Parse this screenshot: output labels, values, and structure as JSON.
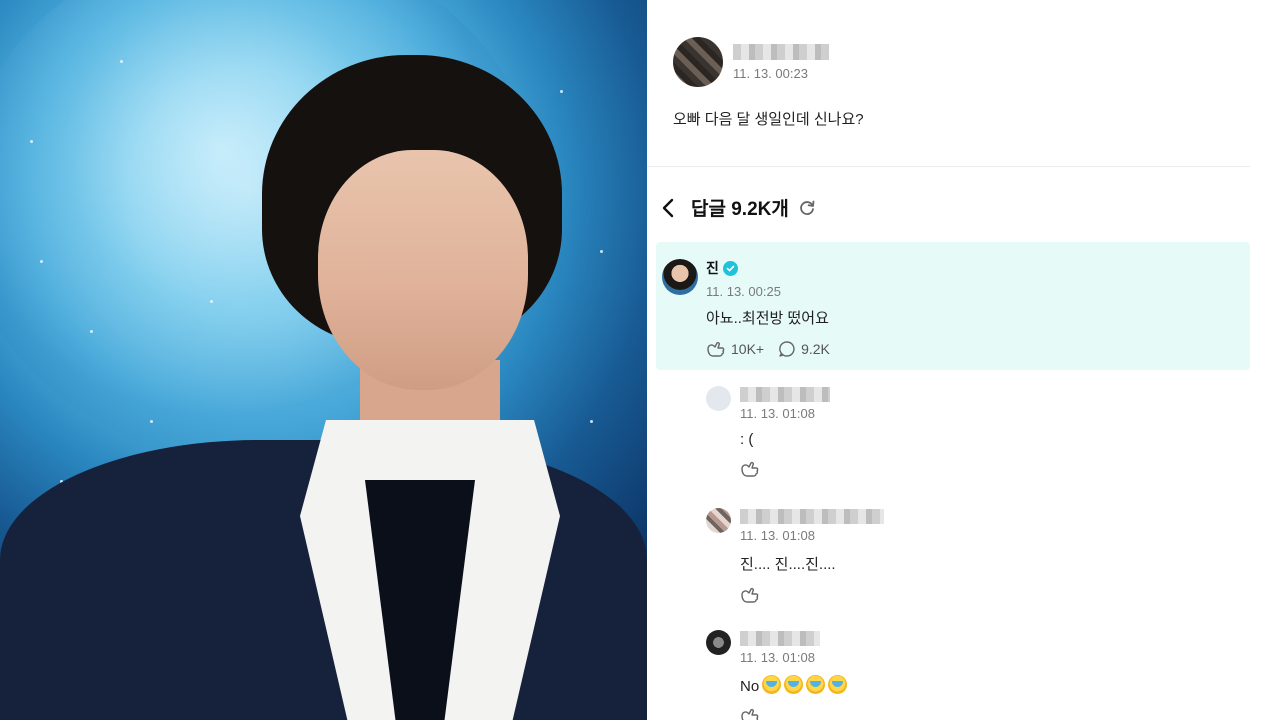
{
  "post": {
    "time": "11. 13. 00:23",
    "text": "오빠 다음 달 생일인데 신나요?"
  },
  "replies_header": {
    "title": "답글 9.2K개"
  },
  "highlighted_reply": {
    "author": "진",
    "time": "11. 13. 00:25",
    "text": "아뇨..최전방 떴어요",
    "likes": "10K+",
    "comments": "9.2K"
  },
  "comments": [
    {
      "time": "11. 13. 01:08",
      "text": ": ("
    },
    {
      "time": "11. 13. 01:08",
      "text": "진.... 진....진...."
    },
    {
      "time": "11. 13. 01:08",
      "text": "No"
    }
  ],
  "colors": {
    "highlight_bg": "#e6fbf7",
    "verified": "#1fc2d8",
    "divider": "#ececec"
  },
  "icons": [
    "back-icon",
    "refresh-icon",
    "verified-icon",
    "like-icon",
    "comment-icon",
    "crying-emoji-icon"
  ]
}
